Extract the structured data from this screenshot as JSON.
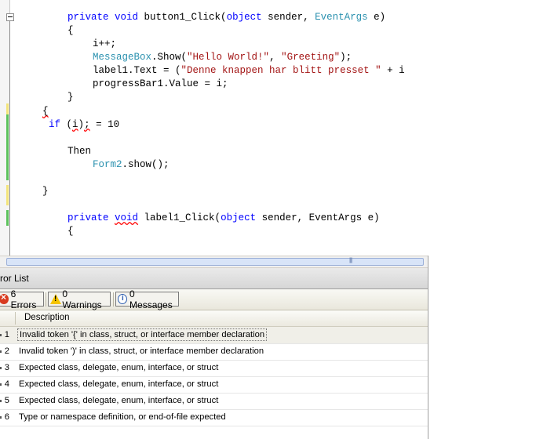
{
  "editor": {
    "lines": [
      {
        "segments": [
          {
            "t": "private ",
            "c": "kw"
          },
          {
            "t": "void ",
            "c": "kw"
          },
          {
            "t": "button1_Click(",
            "c": ""
          },
          {
            "t": "object ",
            "c": "kw"
          },
          {
            "t": "sender, ",
            "c": ""
          },
          {
            "t": "EventArgs ",
            "c": "ty"
          },
          {
            "t": "e)",
            "c": ""
          }
        ]
      },
      {
        "segments": [
          {
            "t": "{",
            "c": ""
          }
        ]
      },
      {
        "segments": [
          {
            "t": "i++;",
            "c": ""
          }
        ]
      },
      {
        "segments": [
          {
            "t": "MessageBox",
            "c": "ty"
          },
          {
            "t": ".Show(",
            "c": ""
          },
          {
            "t": "\"Hello World!\"",
            "c": "st"
          },
          {
            "t": ", ",
            "c": ""
          },
          {
            "t": "\"Greeting\"",
            "c": "st"
          },
          {
            "t": ");",
            "c": ""
          }
        ]
      },
      {
        "segments": [
          {
            "t": "label1.Text = (",
            "c": ""
          },
          {
            "t": "\"Denne knappen har blitt presset \"",
            "c": "st"
          },
          {
            "t": " + i",
            "c": ""
          }
        ]
      },
      {
        "segments": [
          {
            "t": "progressBar1.Value = i;",
            "c": ""
          }
        ]
      },
      {
        "segments": [
          {
            "t": "}",
            "c": ""
          }
        ]
      },
      {
        "segments": [
          {
            "t": "{",
            "c": "squig"
          }
        ]
      },
      {
        "segments": [
          {
            "t": "if ",
            "c": "kw"
          },
          {
            "t": "(",
            "c": ""
          },
          {
            "t": "i",
            "c": "squig"
          },
          {
            "t": ")",
            "c": ""
          },
          {
            "t": ";",
            "c": "squig"
          },
          {
            "t": " = 10",
            "c": ""
          }
        ]
      },
      {
        "segments": [
          {
            "t": "Then",
            "c": ""
          }
        ]
      },
      {
        "segments": [
          {
            "t": "Form2",
            "c": "ty"
          },
          {
            "t": ".show();",
            "c": ""
          }
        ]
      },
      {
        "segments": [
          {
            "t": "}",
            "c": ""
          }
        ]
      },
      {
        "segments": [
          {
            "t": "private ",
            "c": "kw"
          },
          {
            "t": "void",
            "c": "kw squig"
          },
          {
            "t": " label1_Click(",
            "c": ""
          },
          {
            "t": "object ",
            "c": "kw"
          },
          {
            "t": "sender, EventArgs e)",
            "c": ""
          }
        ]
      },
      {
        "segments": [
          {
            "t": "{",
            "c": ""
          }
        ]
      }
    ]
  },
  "error_list": {
    "title": "ror List",
    "filters": {
      "errors": "6 Errors",
      "warnings": "0 Warnings",
      "messages": "0 Messages"
    },
    "column_description": "Description",
    "rows": [
      {
        "num": "1",
        "desc": "Invalid token '{' in class, struct, or interface member declaration"
      },
      {
        "num": "2",
        "desc": "Invalid token ')' in class, struct, or interface member declaration"
      },
      {
        "num": "3",
        "desc": "Expected class, delegate, enum, interface, or struct"
      },
      {
        "num": "4",
        "desc": "Expected class, delegate, enum, interface, or struct"
      },
      {
        "num": "5",
        "desc": "Expected class, delegate, enum, interface, or struct"
      },
      {
        "num": "6",
        "desc": "Type or namespace definition, or end-of-file expected"
      }
    ]
  }
}
